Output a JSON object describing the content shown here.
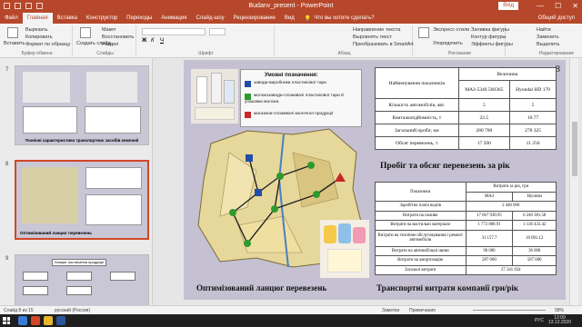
{
  "window": {
    "title": "Budanv_present - PowerPoint",
    "account": "Вхід",
    "min": "—",
    "max": "☐",
    "close": "✕"
  },
  "tabs": [
    "Файл",
    "Главная",
    "Вставка",
    "Конструктор",
    "Переходы",
    "Анимация",
    "Слайд-шоу",
    "Рецензирование",
    "Вид"
  ],
  "tellme": "Что вы хотите сделать?",
  "share": "Общий доступ",
  "ribbon": {
    "paste": "Вставить",
    "cut": "Вырезать",
    "copy": "Копировать",
    "format": "Формат по образцу",
    "clipboard": "Буфер обмена",
    "new_slide": "Создать слайд",
    "layout": "Макет",
    "reset": "Восстановить",
    "section": "Раздел",
    "slides": "Слайды",
    "font": "Шрифт",
    "paragraph": "Абзац",
    "text_direction": "Направление текста",
    "align_text": "Выровнять текст",
    "smartart": "Преобразовать в SmartArt",
    "arrange": "Упорядочить",
    "quick_styles": "Экспресс-стили",
    "drawing": "Рисование",
    "fill": "Заливка фигуры",
    "outline": "Контур фигуры",
    "effects": "Эффекты фигуры",
    "find": "Найти",
    "replace": "Заменить",
    "select": "Выделить",
    "editing": "Редактирование"
  },
  "thumbnails": [
    {
      "num": "7",
      "caption": "Технічні характеристики транспортних засобів компанії"
    },
    {
      "num": "8",
      "caption": "Оптимізований ланцюг перевезень"
    },
    {
      "num": "9",
      "caption": "Ланцюг постачання продукції"
    }
  ],
  "slide": {
    "number": "8",
    "legend": {
      "title": "Умовні позначення:",
      "items": [
        "заводи-виробники пластикової тари",
        "молокозаводи-споживачі пластикової тари й упаковки молока",
        "магазини-споживачі молочної продукції"
      ]
    },
    "table1": {
      "h1": "Найменування показників",
      "h2": "Величина",
      "c1": "МАЗ-5340 560365",
      "c2": "Hyundai HD 170",
      "rows": [
        [
          "Кількість автомобілів, авт.",
          "5",
          "5"
        ],
        [
          "Вантажопідйомність, т",
          "22.5",
          "10.77"
        ],
        [
          "Загальний пробіг, км",
          "280 700",
          "278 325"
        ],
        [
          "Обсяг перевезень, т",
          "17 500",
          "11 250"
        ]
      ]
    },
    "caption_right_top": "Пробіг та обсяг перевезень за рік",
    "table2": {
      "h1": "Показники",
      "h2": "Витрати за рік, грн",
      "c1": "МАЗ",
      "c2": "Hyundai",
      "rows": [
        [
          "Заробітна плата водіїв",
          "2 440 000",
          ""
        ],
        [
          "Витрати на паливо",
          "17 667 930.95",
          "6 240 381.58"
        ],
        [
          "Витрати на мастильні матеріали",
          "1 772 808.91",
          "1 136 433.42"
        ],
        [
          "Витрати на технічне обслуговування і ремонт автомобілів",
          "31 157.7",
          "18 091.12"
        ],
        [
          "Витрати на автомобільні шини",
          "90 000",
          "36 000"
        ],
        [
          "Витрати на амортизацію",
          "287 000",
          "587 000"
        ],
        [
          "Загальні витрати",
          "27 341 834",
          ""
        ]
      ]
    },
    "caption_left": "Оптимізований ланцюг перевезень",
    "caption_right_bottom": "Транспортні витрати компанії грн/рік"
  },
  "status": {
    "slide_of": "Слайд 8 из 15",
    "lang": "русский (Россия)",
    "notes": "Заметки",
    "comments": "Примечания",
    "zoom": "58%"
  },
  "taskbar": {
    "lang": "РУС",
    "time": "12:09",
    "date": "13.12.2020"
  },
  "colors": {
    "accent": "#b7472a",
    "legend_factory": "#1f4ea8",
    "legend_dairy": "#2e9a2e",
    "legend_shop": "#c62828"
  }
}
